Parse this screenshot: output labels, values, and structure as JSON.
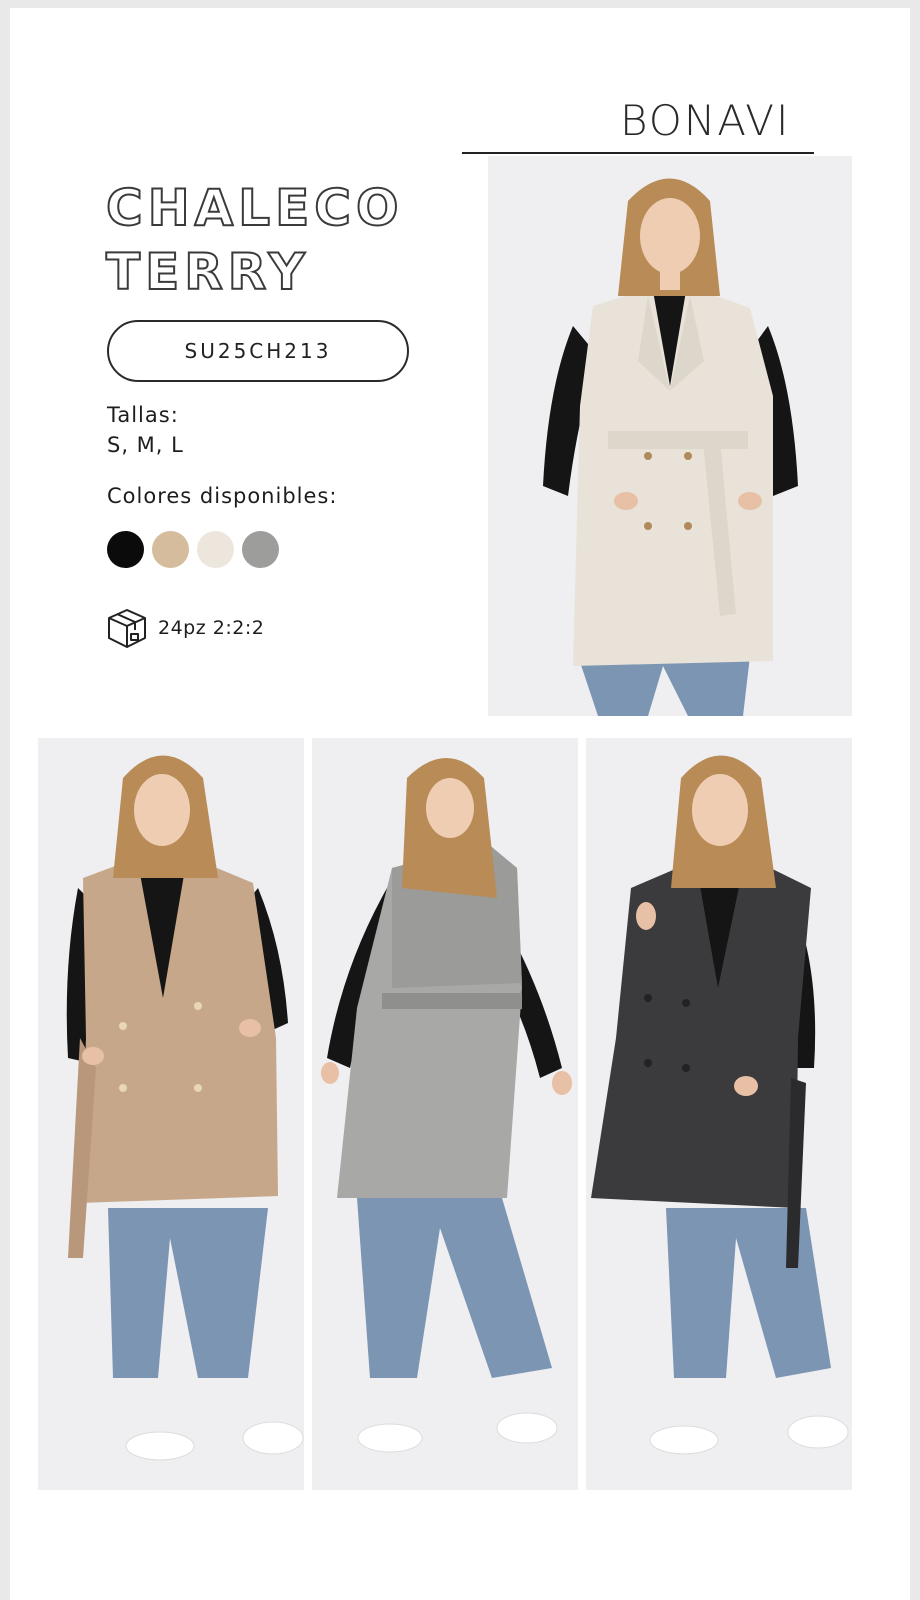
{
  "brand": {
    "name": "BONAVI"
  },
  "product": {
    "title_lines": [
      "CHALECO",
      "TERRY"
    ],
    "sku": "SU25CH213",
    "sizes_label": "Tallas:",
    "sizes": "S, M, L",
    "colors_label": "Colores disponibles:",
    "colors": [
      {
        "name": "black",
        "hex": "#0b0b0b"
      },
      {
        "name": "camel",
        "hex": "#d4bc9c"
      },
      {
        "name": "ivory",
        "hex": "#ede6dc"
      },
      {
        "name": "gray",
        "hex": "#9d9e9c"
      }
    ],
    "pack_icon": "box-icon",
    "pack": "24pz 2:2:2"
  },
  "photos": [
    {
      "name": "main-ivory-photo",
      "vest_color": "#e8e2d8"
    },
    {
      "name": "camel-photo",
      "vest_color": "#c7a789"
    },
    {
      "name": "gray-back-photo",
      "vest_color": "#a8a8a6"
    },
    {
      "name": "charcoal-photo",
      "vest_color": "#3b3b3d"
    }
  ]
}
